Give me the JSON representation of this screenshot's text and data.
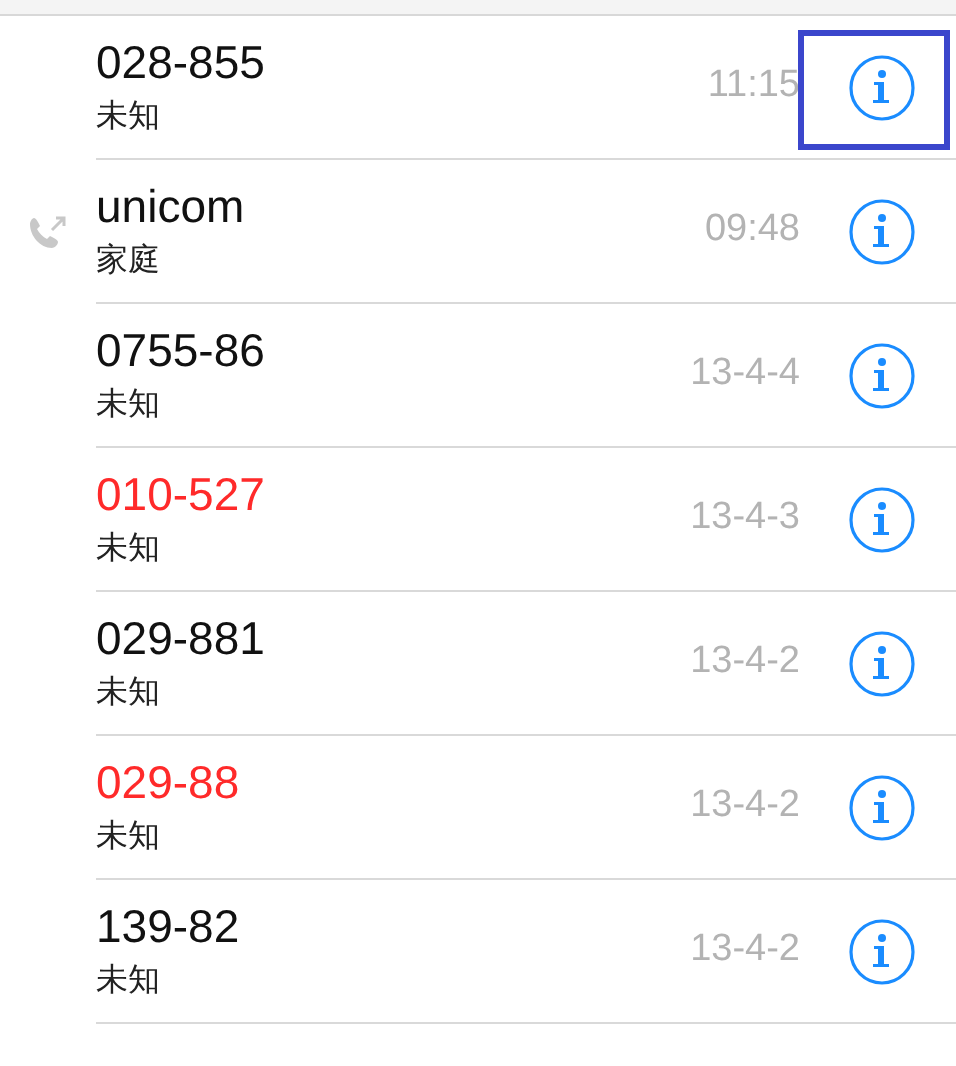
{
  "calls": [
    {
      "number": "028-855",
      "label": "未知",
      "time": "11:15",
      "missed": false,
      "outgoing": false,
      "highlighted": true
    },
    {
      "number": "unicom",
      "label": "家庭",
      "time": "09:48",
      "missed": false,
      "outgoing": true,
      "highlighted": false
    },
    {
      "number": "0755-86",
      "label": "未知",
      "time": "13-4-4",
      "missed": false,
      "outgoing": false,
      "highlighted": false
    },
    {
      "number": "010-527",
      "label": "未知",
      "time": "13-4-3",
      "missed": true,
      "outgoing": false,
      "highlighted": false
    },
    {
      "number": "029-881",
      "label": "未知",
      "time": "13-4-2",
      "missed": false,
      "outgoing": false,
      "highlighted": false
    },
    {
      "number": "029-88",
      "label": "未知",
      "time": "13-4-2",
      "missed": true,
      "outgoing": false,
      "highlighted": false
    },
    {
      "number": "139-82",
      "label": "未知",
      "time": "13-4-2",
      "missed": false,
      "outgoing": false,
      "highlighted": false
    }
  ]
}
